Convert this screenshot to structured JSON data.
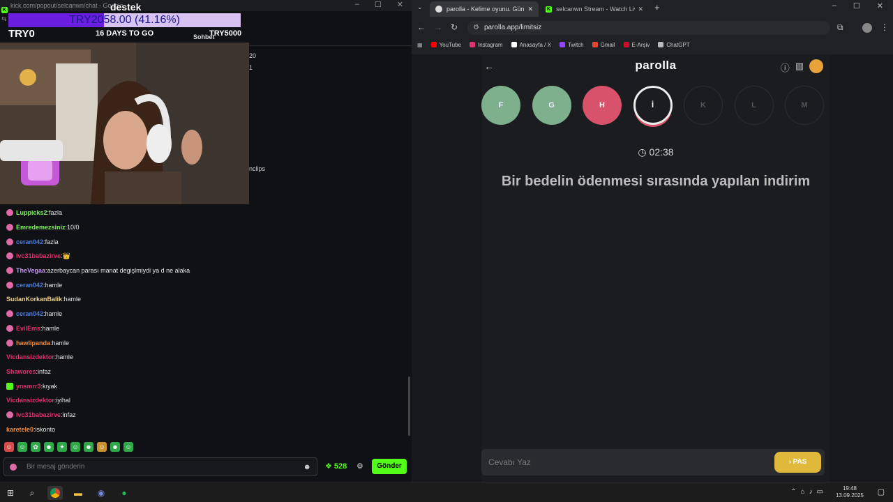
{
  "left_window": {
    "title": "kick.com/popout/selcanwn/chat - Google",
    "donation": {
      "text": "TRY2058.00 (41.16%)",
      "progress": 0.4116,
      "title": "destek",
      "start": "TRY0",
      "end": "TRY5000",
      "days_left": "16 DAYS TO GO"
    },
    "chat_header": "Sohbet",
    "side_fragments": [
      "20",
      "1",
      "nclips"
    ],
    "messages": [
      {
        "user": "Luppicks2",
        "text": "fazla",
        "color": "#7cf25a",
        "badge": "pink"
      },
      {
        "user": "Emredemezsiniz",
        "text": "10/0",
        "color": "#7cf25a",
        "badge": "pink"
      },
      {
        "user": "ceran042",
        "text": "fazla",
        "color": "#4c7bdc",
        "badge": "pink"
      },
      {
        "user": "lvc31babazirve",
        "text": "👑",
        "color": "#e0306a",
        "badge": "pink"
      },
      {
        "user": "TheVegaa",
        "text": "azerbaycan parası manat degişlmiydi ya d ne alaka",
        "color": "#c893f5",
        "badge": "pink"
      },
      {
        "user": "ceran042",
        "text": "hamle",
        "color": "#4c7bdc",
        "badge": "pink"
      },
      {
        "user": "SudanKorkanBalik",
        "text": "hamle",
        "color": "#f0d28a",
        "badge": ""
      },
      {
        "user": "ceran042",
        "text": "hamle",
        "color": "#4c7bdc",
        "badge": "pink"
      },
      {
        "user": "EvilEms",
        "text": "hamle",
        "color": "#e0306a",
        "badge": "pink"
      },
      {
        "user": "hawlipanda",
        "text": "hamle",
        "color": "#f08a3a",
        "badge": "pink"
      },
      {
        "user": "Vicdansizdektor",
        "text": "hamle",
        "color": "#e0306a",
        "badge": ""
      },
      {
        "user": "Shawores",
        "text": "infaz",
        "color": "#e0306a",
        "badge": ""
      },
      {
        "user": "ynsmrr3",
        "text": "kıyak",
        "color": "#e0306a",
        "badge": "green"
      },
      {
        "user": "Vicdansizdektor",
        "text": "iyihal",
        "color": "#e0306a",
        "badge": ""
      },
      {
        "user": "lvc31babazirve",
        "text": "infaz",
        "color": "#e0306a",
        "badge": "pink"
      },
      {
        "user": "karetele0",
        "text": "iskonto",
        "color": "#f08a3a",
        "badge": ""
      }
    ],
    "chat_input_placeholder": "Bir mesaj gönderin",
    "points": "528",
    "send_label": "Gönder"
  },
  "browser": {
    "tabs": [
      {
        "label": "parolla - Kelime oyunu. Günlük",
        "active": true
      },
      {
        "label": "selcanwn Stream - Watch Live",
        "active": false
      }
    ],
    "url": "parolla.app/limitsiz",
    "bookmarks": [
      {
        "label": "YouTube",
        "color": "#ff0000"
      },
      {
        "label": "Instagram",
        "color": "#e1306c"
      },
      {
        "label": "Anasayfa / X",
        "color": "#ffffff"
      },
      {
        "label": "Twitch",
        "color": "#9146ff"
      },
      {
        "label": "Gmail",
        "color": "#ea4335"
      },
      {
        "label": "E-Arşiv",
        "color": "#c8102e"
      },
      {
        "label": "ChatGPT",
        "color": "#bbbbbb"
      }
    ]
  },
  "game": {
    "logo": "parolla",
    "letters": [
      {
        "char": "F",
        "state": "correct"
      },
      {
        "char": "G",
        "state": "correct"
      },
      {
        "char": "H",
        "state": "wrong"
      },
      {
        "char": "İ",
        "state": "active"
      },
      {
        "char": "K",
        "state": "empty"
      },
      {
        "char": "L",
        "state": "empty"
      },
      {
        "char": "M",
        "state": "empty"
      }
    ],
    "timer": "02:38",
    "question": "Bir bedelin ödenmesi sırasında yapılan indirim",
    "answer_placeholder": "Cevabı Yaz",
    "pass_label": "PAS"
  },
  "taskbar": {
    "time": "19:48",
    "date": "13.09.2025"
  }
}
